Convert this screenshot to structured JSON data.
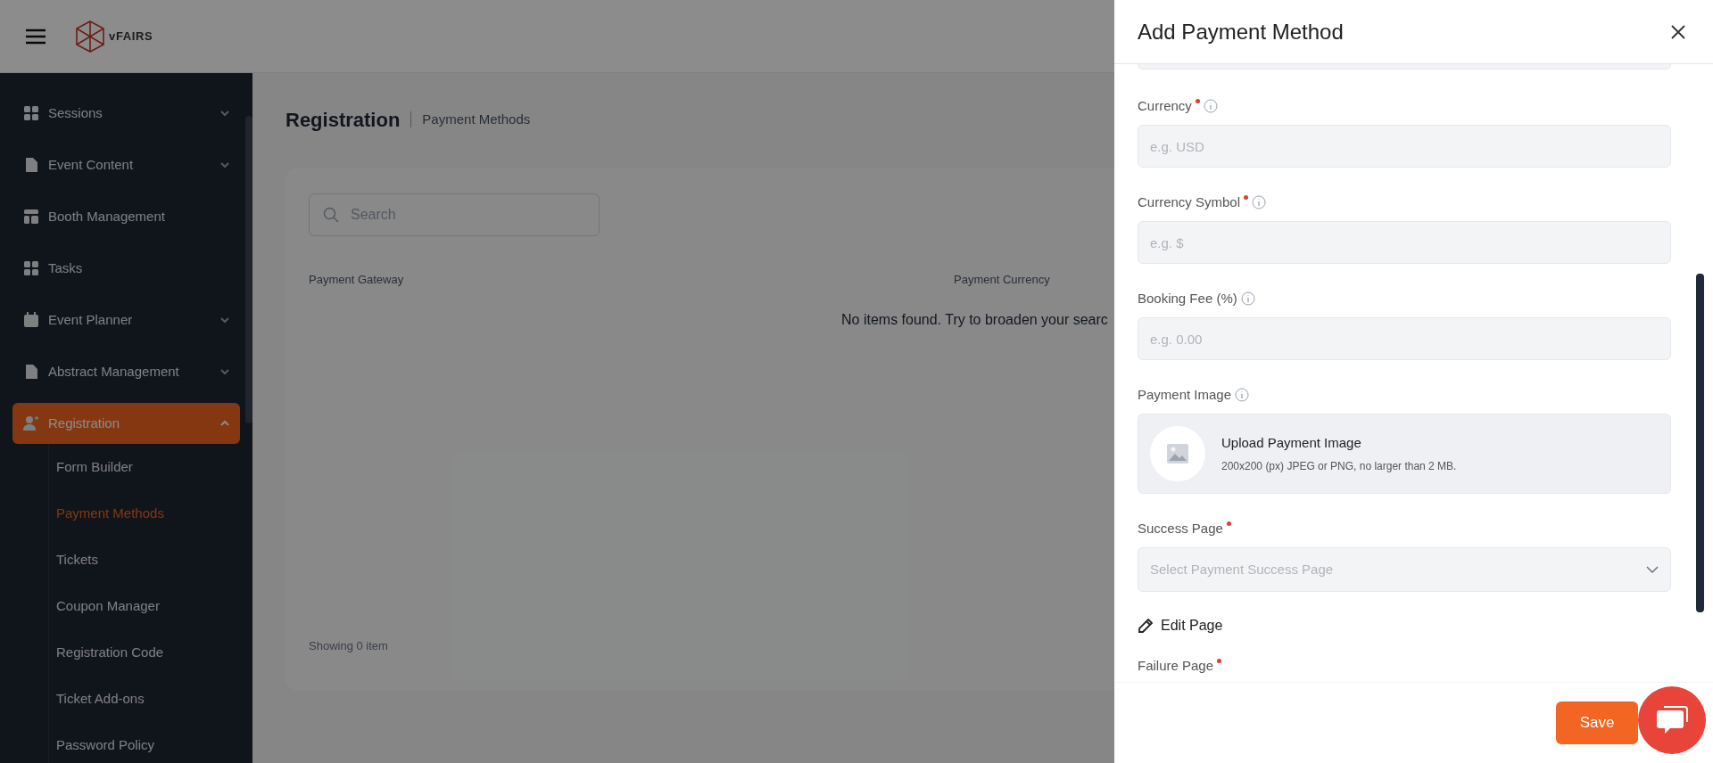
{
  "header": {
    "logo_text": "vFAIRS"
  },
  "sidebar": {
    "items": [
      {
        "label": "Sessions",
        "expanded": false
      },
      {
        "label": "Event Content",
        "expanded": false
      },
      {
        "label": "Booth Management"
      },
      {
        "label": "Tasks"
      },
      {
        "label": "Event Planner",
        "expanded": false
      },
      {
        "label": "Abstract Management",
        "expanded": false
      },
      {
        "label": "Registration",
        "expanded": true,
        "selected": true,
        "children": [
          {
            "label": "Form Builder",
            "selected": false
          },
          {
            "label": "Payment Methods",
            "selected": true
          },
          {
            "label": "Tickets",
            "selected": false
          },
          {
            "label": "Coupon Manager",
            "selected": false
          },
          {
            "label": "Registration Code",
            "selected": false
          },
          {
            "label": "Ticket Add-ons",
            "selected": false
          },
          {
            "label": "Password Policy",
            "selected": false
          }
        ]
      }
    ]
  },
  "main": {
    "title": "Registration",
    "breadcrumb": "Payment Methods",
    "search": {
      "placeholder": "Search"
    },
    "columns": [
      "Payment Gateway",
      "Payment Currency"
    ],
    "empty_message": "No items found. Try to broaden your searc",
    "footer": "Showing 0 item"
  },
  "panel": {
    "title": "Add Payment Method",
    "fields": [
      {
        "kind": "input",
        "label": "Currency",
        "required": true,
        "info": true,
        "placeholder": "e.g. USD"
      },
      {
        "kind": "input",
        "label": "Currency Symbol",
        "required": true,
        "info": true,
        "placeholder": "e.g. $"
      },
      {
        "kind": "input",
        "label": "Booking Fee (%)",
        "required": false,
        "info": true,
        "placeholder": "e.g. 0.00"
      },
      {
        "kind": "upload",
        "label": "Payment Image",
        "required": false,
        "info": true,
        "title": "Upload Payment Image",
        "hint": "200x200 (px) JPEG or PNG, no larger than 2 MB."
      },
      {
        "kind": "select",
        "label": "Success Page",
        "required": true,
        "info": false,
        "placeholder": "Select Payment Success Page"
      },
      {
        "kind": "link",
        "label": "Edit Page"
      },
      {
        "kind": "label",
        "label": "Failure Page",
        "required": true,
        "info": false
      }
    ],
    "save": "Save"
  }
}
